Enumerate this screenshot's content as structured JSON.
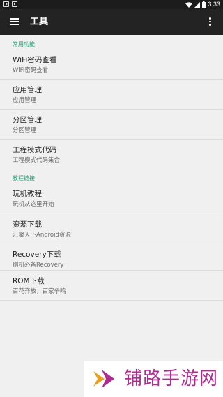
{
  "status_bar": {
    "time": "3:33"
  },
  "app_bar": {
    "title": "工具"
  },
  "sections": [
    {
      "header": "常用功能",
      "items": [
        {
          "title": "WiFi密码查看",
          "subtitle": "WiFi密码查看"
        },
        {
          "title": "应用管理",
          "subtitle": "应用管理"
        },
        {
          "title": "分区管理",
          "subtitle": "分区管理"
        },
        {
          "title": "工程模式代码",
          "subtitle": "工程模式代码集合"
        }
      ]
    },
    {
      "header": "教程链接",
      "items": [
        {
          "title": "玩机教程",
          "subtitle": "玩机从这里开始"
        },
        {
          "title": "资源下载",
          "subtitle": "汇聚天下Android资源"
        },
        {
          "title": "Recovery下载",
          "subtitle": "刷机必备Recovery"
        },
        {
          "title": "ROM下载",
          "subtitle": "百花齐放，百家争鸣"
        }
      ]
    }
  ],
  "watermark": {
    "text": "铺路手游网"
  },
  "colors": {
    "accent": "#1a9e6f",
    "app_bar": "#232323",
    "background": "#f0f0f0",
    "watermark": "#b02a8f"
  }
}
